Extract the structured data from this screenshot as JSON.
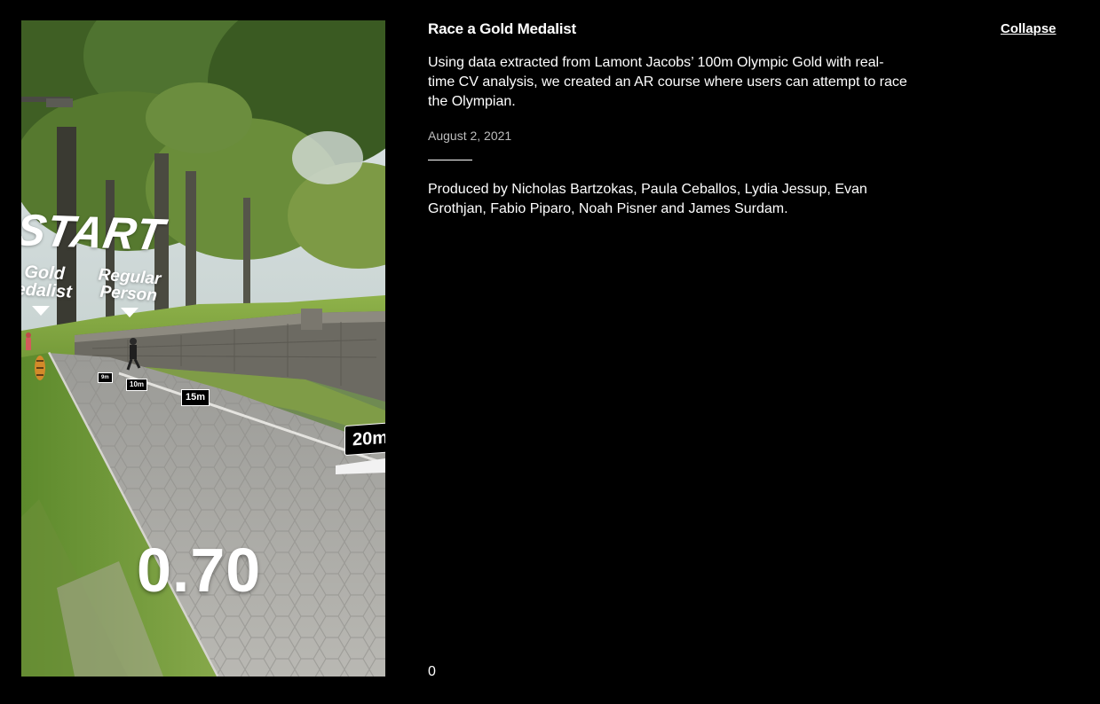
{
  "project": {
    "title": "Race a Gold Medalist",
    "collapse_label": "Collapse",
    "description": "Using data extracted from Lamont Jacobs’ 100m Olympic Gold with real-time CV analysis, we created an AR course where users can attempt to race the Olympian.",
    "date": "August 2, 2021",
    "credits": "Produced by Nicholas Bartzokas, Paula Ceballos, Lydia Jessup, Evan Grothjan, Fabio Piparo, Noah Pisner and James Surdam.",
    "counter": "0"
  },
  "media": {
    "overlay": {
      "start_label": "START",
      "gold_label": "Gold\nedalist",
      "regular_label": "Regular\nPerson",
      "markers": [
        "9m",
        "10m",
        "15m",
        "20m"
      ],
      "timer": "0.70"
    }
  }
}
